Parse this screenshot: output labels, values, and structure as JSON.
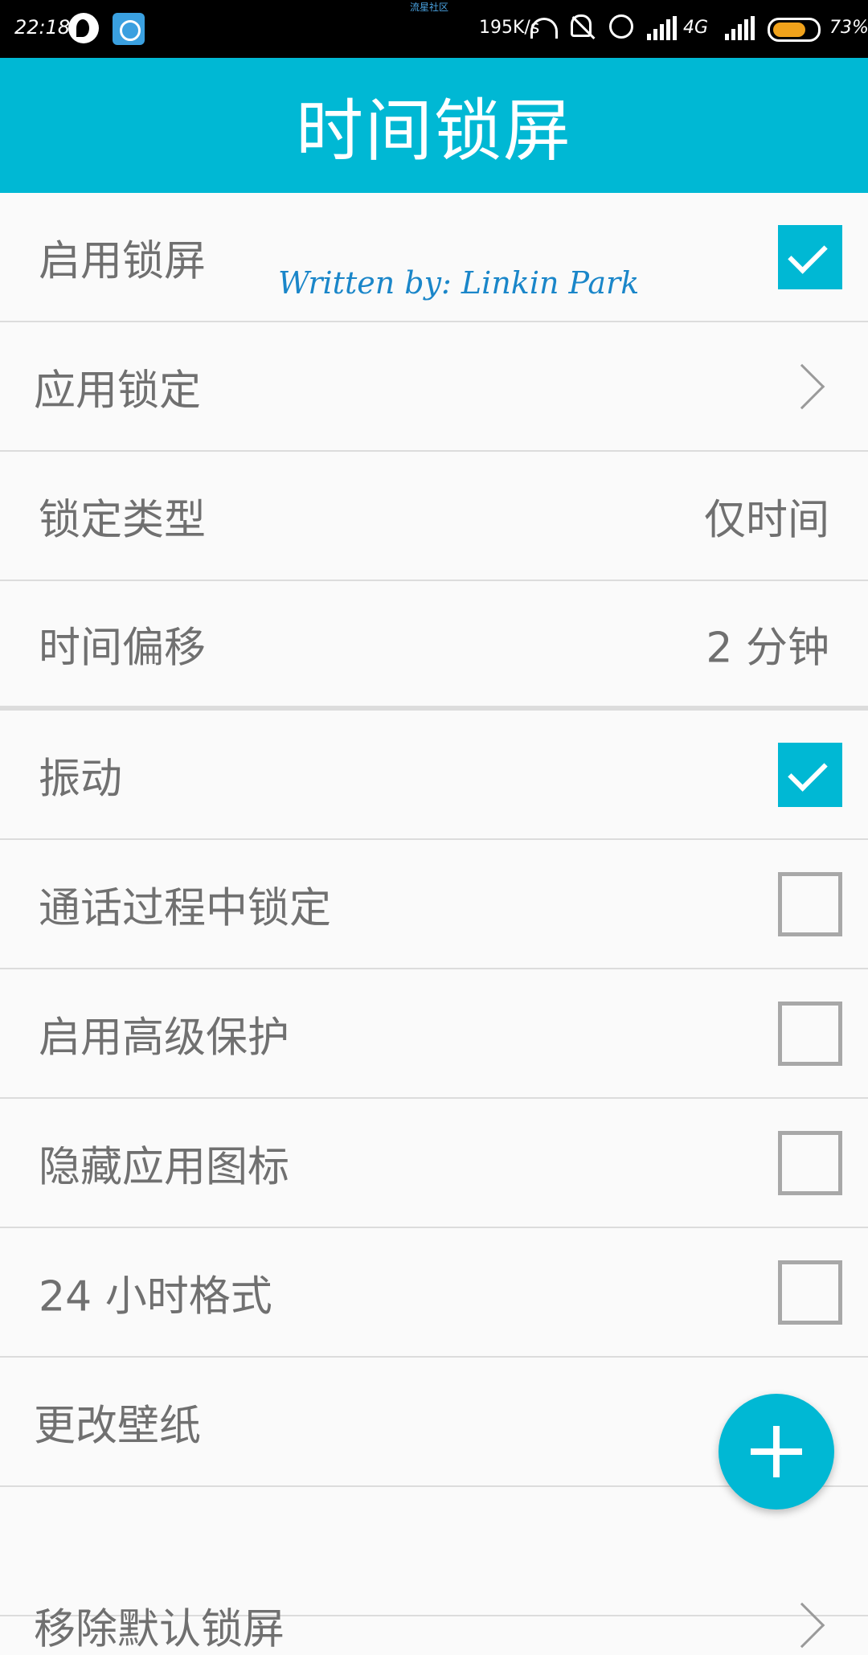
{
  "status_bar": {
    "time": "22:18",
    "center_text": "流星社区",
    "speed": "195K/s",
    "network": "4G",
    "battery": "73%"
  },
  "app_bar": {
    "title": "时间锁屏"
  },
  "watermark": "Written by:  Linkin Park",
  "colors": {
    "accent": "#00b8d4",
    "text": "#707070",
    "divider": "#dcdcdc"
  },
  "settings": [
    {
      "label": "启用锁屏",
      "control": "checkbox",
      "checked": true
    },
    {
      "label": "应用锁定",
      "control": "chevron"
    },
    {
      "label": "锁定类型",
      "control": "value",
      "value": "仅时间"
    },
    {
      "label": "时间偏移",
      "control": "value",
      "value": "2 分钟"
    },
    {
      "label": "振动",
      "control": "checkbox",
      "checked": true
    },
    {
      "label": "通话过程中锁定",
      "control": "checkbox",
      "checked": false
    },
    {
      "label": "启用高级保护",
      "control": "checkbox",
      "checked": false
    },
    {
      "label": "隐藏应用图标",
      "control": "checkbox",
      "checked": false
    },
    {
      "label": "24 小时格式",
      "control": "checkbox",
      "checked": false
    },
    {
      "label": "更改壁纸",
      "control": "none"
    },
    {
      "label": "移除默认锁屏",
      "control": "chevron"
    }
  ],
  "fab": {
    "icon": "plus-icon"
  }
}
